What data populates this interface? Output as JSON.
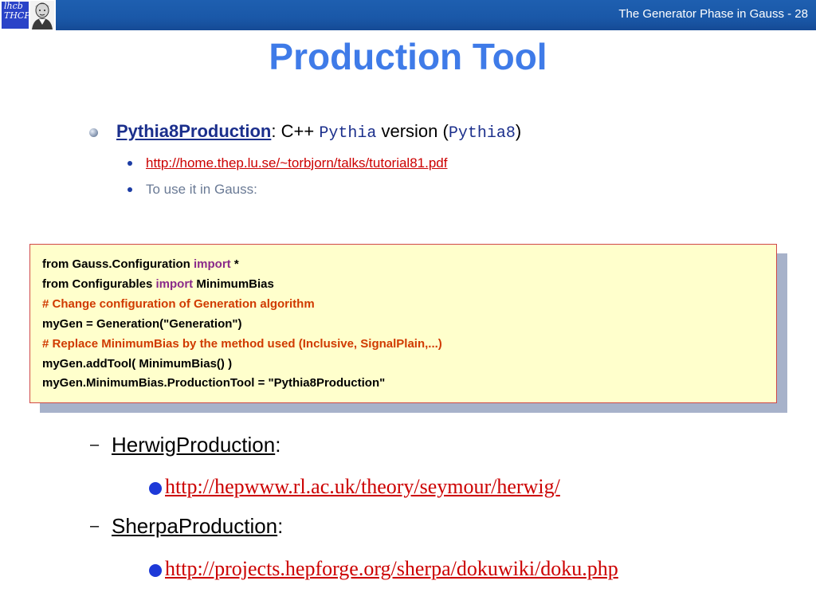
{
  "header": {
    "logo_text_1": "lhcb",
    "logo_text_2": "THCP",
    "slide_title": "The Generator Phase in Gauss - 28"
  },
  "title": "Production Tool",
  "pythia": {
    "name": "Pythia8Production",
    "sep": ":",
    "cpp": "C++",
    "pythia_mono": "Pythia",
    "version_word": "version (",
    "pythia8_mono": "Pythia8",
    "close_paren": ")",
    "url": "http://home.thep.lu.se/~torbjorn/talks/tutorial81.pdf",
    "use_text": "To use it in Gauss:"
  },
  "code": {
    "line1_a": "from Gauss.Configuration ",
    "line1_kw": "import",
    "line1_b": " *",
    "line2_a": "from Configurables ",
    "line2_kw": "import",
    "line2_b": " MinimumBias",
    "line3_comment": "# Change configuration of Generation algorithm",
    "line4": "myGen = Generation(\"Generation\")",
    "line5_comment": "# Replace MinimumBias by the method used (Inclusive, SignalPlain,...)",
    "line6": "myGen.addTool( MinimumBias() )",
    "line7": "myGen.MinimumBias.ProductionTool = \"Pythia8Production\""
  },
  "herwig": {
    "dash": "–",
    "name": "HerwigProduction",
    "colon": ":",
    "url": "http://hepwww.rl.ac.uk/theory/seymour/herwig/"
  },
  "sherpa": {
    "dash": "–",
    "name": "SherpaProduction",
    "colon": ":",
    "url": "http://projects.hepforge.org/sherpa/dokuwiki/doku.php"
  },
  "colors": {
    "header_bg": "#1a58a8",
    "title": "#3f7be8",
    "link_red": "#cc0000",
    "code_bg": "#ffffcc",
    "code_keyword": "#8a2a8a",
    "code_comment": "#d03a00"
  },
  "icons": [
    "lhcb-logo-icon",
    "portrait-icon",
    "sphere-bullet-icon",
    "dot-bullet-icon"
  ]
}
